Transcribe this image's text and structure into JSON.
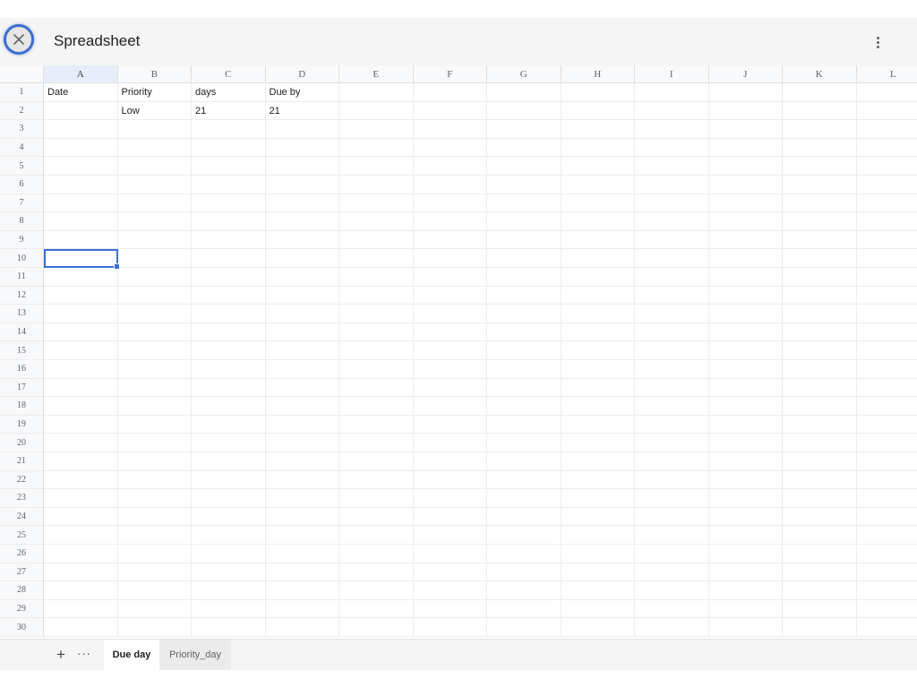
{
  "app": {
    "title": "Spreadsheet",
    "close_icon": "close-icon",
    "menu_icon": "more-vert-icon"
  },
  "grid": {
    "columns": [
      "A",
      "B",
      "C",
      "D",
      "E",
      "F",
      "G",
      "H",
      "I",
      "J",
      "K",
      "L"
    ],
    "row_count": 30,
    "selected_column": "A",
    "selected_cell": "A10",
    "cells": {
      "A1": "Date",
      "B1": "Priority",
      "C1": "days",
      "D1": "Due by",
      "B2": "Low",
      "C2": "21",
      "D2": "21"
    }
  },
  "sheets": {
    "add_label": "+",
    "more_label": "···",
    "tabs": [
      {
        "label": "Due day",
        "active": true
      },
      {
        "label": "Priority_day",
        "active": false
      }
    ]
  },
  "colors": {
    "accent": "#3a6fd8",
    "selected_header_bg": "#e8eef9"
  }
}
